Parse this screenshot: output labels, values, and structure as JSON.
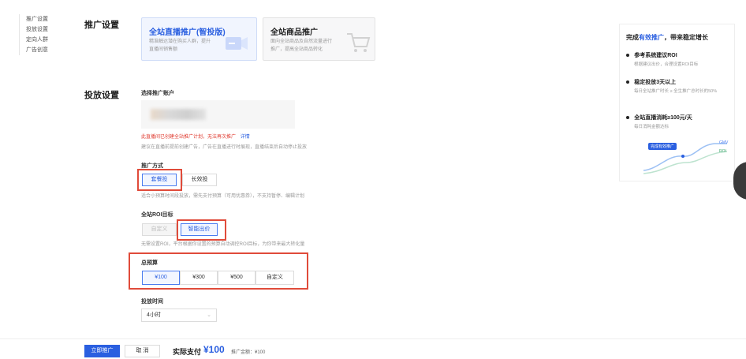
{
  "nav": {
    "items": [
      "推广设置",
      "投放设置",
      "定向人群",
      "广告创意"
    ]
  },
  "sections": {
    "promo_title": "推广设置",
    "delivery_title": "投放设置"
  },
  "cards": {
    "live": {
      "title": "全站直播推广(智投版)",
      "desc1": "精准触达潜在购买人群，提升",
      "desc2": "直播间销售额"
    },
    "goods": {
      "title": "全站商品推广",
      "desc1": "面向全站商品及自然流量进行",
      "desc2": "推广，提高全站商品转化"
    }
  },
  "account": {
    "label": "选择推广账户",
    "warning": "此直播间已创建全站推广计划，无法再次推广",
    "warning_link": "详情",
    "hint": "建议在直播前提前创建广告，广告在直播进行时展现，直播结束后自动停止投放"
  },
  "method": {
    "label": "推广方式",
    "options": [
      "套餐投",
      "长效投"
    ],
    "hint": "适合小预算时间段投放，需先支付预算（可用优惠券），不支持暂停、编辑计划"
  },
  "roi": {
    "label": "全站ROI目标",
    "options": [
      "自定义",
      "智能出价"
    ],
    "hint": "无需设置ROI，平台根据你设置的预算自动调控ROI目标，为你带来最大转化量"
  },
  "budget": {
    "label": "总预算",
    "options": [
      "¥100",
      "¥300",
      "¥500",
      "自定义"
    ]
  },
  "time": {
    "label": "投放时间",
    "value": "4小时"
  },
  "footer": {
    "submit": "立即推广",
    "cancel": "取 消",
    "pay_label": "实际支付",
    "pay_value": "¥100",
    "amount": "推广金额：¥100"
  },
  "right_panel": {
    "title_pre": "完成",
    "title_highlight": "有效推广",
    "title_post": "，带来稳定增长",
    "items": [
      {
        "title": "参考系统建议ROI",
        "sub": "根据建议出价，合理设置ROI目标"
      },
      {
        "title": "稳定投放3天以上",
        "sub": "每日全站推广时长 ≥ 全生推广总时长的50%"
      },
      {
        "title": "全站直播消耗≥100元/天",
        "sub": "每日消耗金额达标"
      }
    ],
    "chart_tag": "完成有效推广",
    "chart_labels": [
      "GMV",
      "ROI"
    ]
  },
  "colors": {
    "accent": "#2a5fe0",
    "warning": "#e03c31",
    "highlight_box": "#e04b3a"
  }
}
